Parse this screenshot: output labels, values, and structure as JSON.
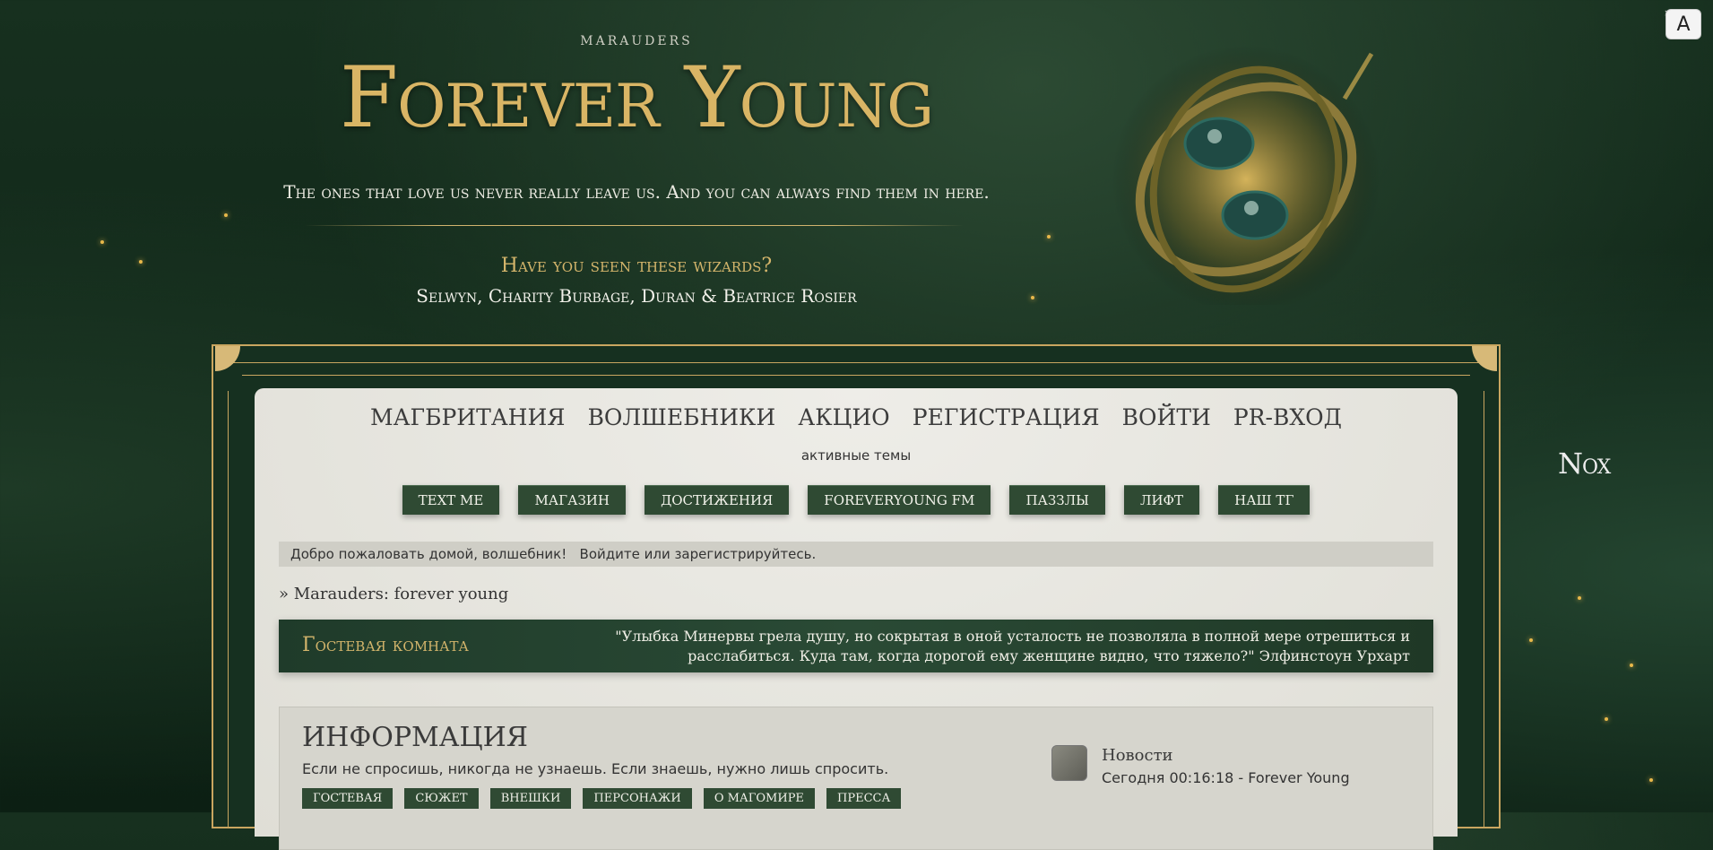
{
  "header": {
    "site_sub": "MARAUDERS",
    "site_title": "Forever Young",
    "tagline": "The ones that love us never really leave us. And you can always find them in here.",
    "wanted_title": "Have you seen these wizards?",
    "wanted_names": "Selwyn, Charity Burbage, Duran & Beatrice Rosier"
  },
  "translate": {
    "label": "A",
    "close": "×"
  },
  "side": {
    "nox_label": "Nox"
  },
  "nav": {
    "items": [
      "МАГБРИТАНИЯ",
      "ВОЛШЕБНИКИ",
      "АКЦИО",
      "РЕГИСТРАЦИЯ",
      "ВОЙТИ",
      "PR-ВХОД"
    ],
    "active_topics": "активные темы"
  },
  "quick_links": [
    "TEXT ME",
    "МАГАЗИН",
    "ДОСТИЖЕНИЯ",
    "FOREVERYOUNG FM",
    "ПАЗЗЛЫ",
    "ЛИФТ",
    "НАШ ТГ"
  ],
  "welcome": {
    "text": "Добро пожаловать домой, волшебник!",
    "login_prompt": "Войдите или зарегистрируйтесь."
  },
  "breadcrumb": "» Marauders: forever young",
  "guest_room": {
    "title": "Гостевая комната",
    "quote": "\"Улыбка Минервы грела душу, но сокрытая в оной усталость не позволяла в полной мере отрешиться и расслабиться. Куда там, когда дорогой ему женщине видно, что тяжело?\" Элфинстоун Урхарт"
  },
  "info": {
    "title": "ИНФОРМАЦИЯ",
    "subtitle": "Если не спросишь, никогда не узнаешь. Если знаешь, нужно лишь спросить.",
    "tags": [
      "ГОСТЕВАЯ",
      "СЮЖЕТ",
      "ВНЕШКИ",
      "ПЕРСОНАЖИ",
      "О МАГОМИРЕ",
      "ПРЕССА"
    ],
    "news_title": "Новости",
    "news_meta": "Сегодня 00:16:18 - Forever Young"
  },
  "colors": {
    "background": "#123020",
    "gold": "#d9b565",
    "button_green": "#2f4a33",
    "panel": "#e6e5df"
  }
}
